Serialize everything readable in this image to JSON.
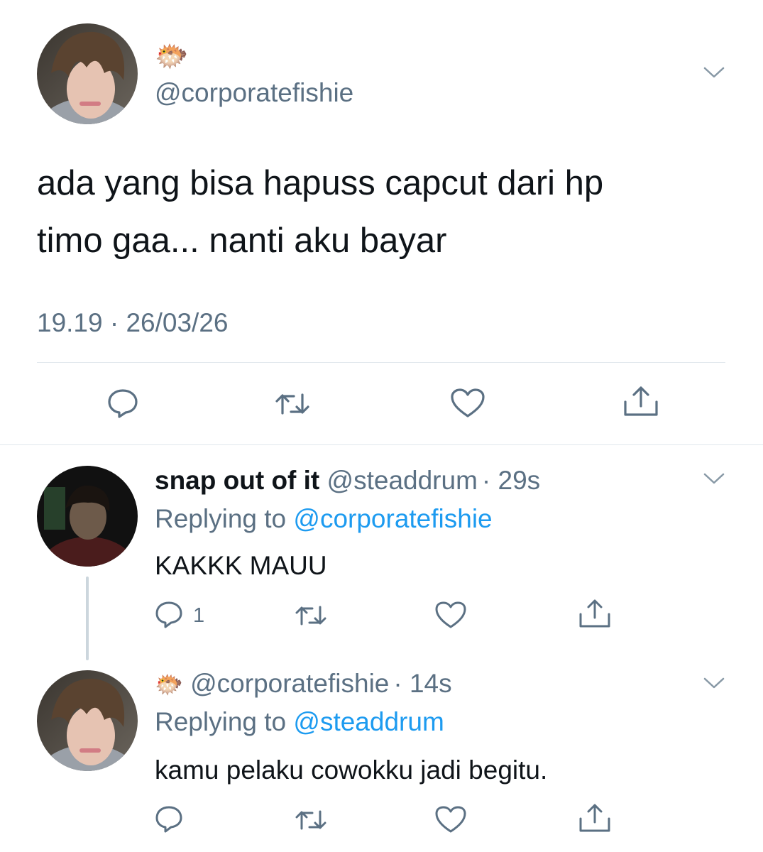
{
  "main_tweet": {
    "display_name_emoji": "🐡",
    "handle": "@corporatefishie",
    "text_line1": "ada yang bisa hapuss capcut dari hp",
    "text_line2": "timo gaa... nanti aku bayar",
    "timestamp": "19.19 · 26/03/26"
  },
  "replies": [
    {
      "display_name": "snap out of it",
      "handle": "@steaddrum",
      "time": "· 29s",
      "replying_prefix": "Replying to",
      "replying_to": "@corporatefishie",
      "text": "KAKKK MAUU",
      "reply_count": "1"
    },
    {
      "display_name_emoji": "🐡",
      "handle": "@corporatefishie",
      "time": "· 14s",
      "replying_prefix": "Replying to",
      "replying_to": "@steaddrum",
      "text": "kamu pelaku cowokku jadi begitu.",
      "reply_count": ""
    }
  ],
  "icons": [
    "reply-icon",
    "retweet-icon",
    "like-icon",
    "share-icon",
    "chevron-down-icon"
  ],
  "colors": {
    "text": "#0f1419",
    "muted": "#5b7083",
    "link": "#1d9bf0",
    "divider": "#e1e8ed"
  }
}
